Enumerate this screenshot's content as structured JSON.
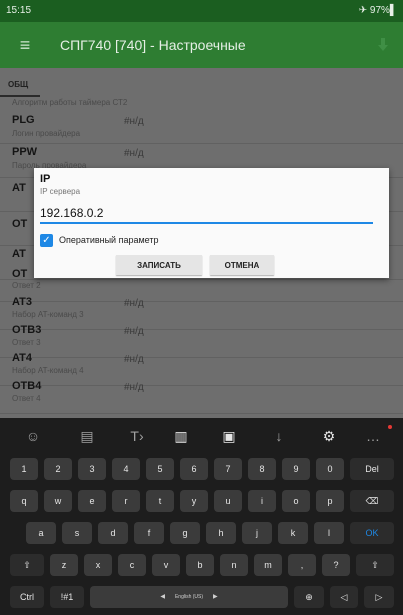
{
  "status": {
    "time": "15:15",
    "right": "✈ 97%▌"
  },
  "toolbar": {
    "title": "СПГ740 [740] - Настроечные",
    "menu_glyph": "≡"
  },
  "tab": {
    "label": "ОБЩ"
  },
  "list": {
    "top_caption": "Алгоритм работы таймера СТ2",
    "rows": [
      {
        "name": "PLG",
        "sub": "Логин провайдера",
        "value": "#н/д"
      },
      {
        "name": "PPW",
        "sub": "Пароль провайдера",
        "value": "#н/д"
      },
      {
        "name": "AT",
        "sub": "",
        "value": ""
      },
      {
        "name": "OT",
        "sub": "",
        "value": ""
      },
      {
        "name": "AT",
        "sub": "",
        "value": ""
      },
      {
        "name": "OT",
        "sub": "Ответ 2",
        "value": ""
      },
      {
        "name": "AT3",
        "sub": "Набор AT-команд 3",
        "value": "#н/д"
      },
      {
        "name": "OTB3",
        "sub": "Ответ 3",
        "value": "#н/д"
      },
      {
        "name": "AT4",
        "sub": "Набор AT-команд 4",
        "value": "#н/д"
      },
      {
        "name": "OTB4",
        "sub": "Ответ 4",
        "value": "#н/д"
      }
    ]
  },
  "dialog": {
    "title": "IP",
    "subtitle": "IP сервера",
    "value": "192.168.0.2",
    "checkbox_label": "Оперативный параметр",
    "checked": true,
    "save": "ЗАПИСАТЬ",
    "cancel": "ОТМЕНА"
  },
  "keyboard": {
    "suggestions": [
      {
        "name": "emoji-icon",
        "glyph": "☺"
      },
      {
        "name": "sticker-icon",
        "glyph": "▤"
      },
      {
        "name": "translate-icon",
        "glyph": "T›"
      },
      {
        "name": "clipboard-icon",
        "glyph": "▥"
      },
      {
        "name": "keyboard-toggle-icon",
        "glyph": "▣"
      },
      {
        "name": "microphone-icon",
        "glyph": "↓"
      },
      {
        "name": "settings-gear-icon",
        "glyph": "⚙"
      },
      {
        "name": "more-icon",
        "glyph": "…"
      }
    ],
    "row1": [
      "1",
      "2",
      "3",
      "4",
      "5",
      "6",
      "7",
      "8",
      "9",
      "0",
      "Del"
    ],
    "row2": [
      "q",
      "w",
      "e",
      "r",
      "t",
      "y",
      "u",
      "i",
      "o",
      "p",
      "⌫"
    ],
    "row3": [
      "a",
      "s",
      "d",
      "f",
      "g",
      "h",
      "j",
      "k",
      "l",
      "OK"
    ],
    "row4": [
      "⇧",
      "z",
      "x",
      "c",
      "v",
      "b",
      "n",
      "m",
      ",",
      "?",
      "⇧"
    ],
    "bottom": {
      "ctrl": "Ctrl",
      "sym": "!#1",
      "space": "English (US)",
      "globe": "⊕",
      "left": "◁",
      "right": "▷"
    }
  }
}
